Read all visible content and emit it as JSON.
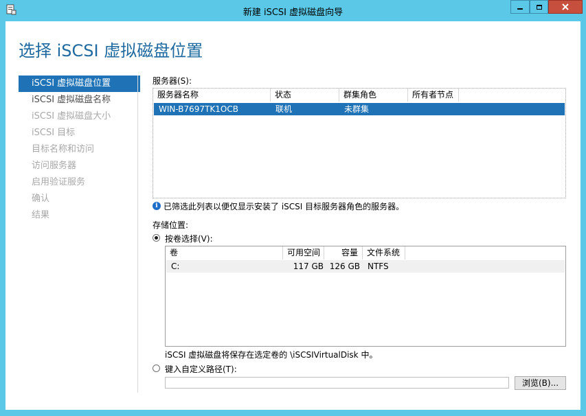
{
  "window": {
    "title": "新建 iSCSI 虚拟磁盘向导",
    "min_glyph": "▁",
    "max_glyph": "□",
    "close_glyph": "✕"
  },
  "page": {
    "title": "选择 iSCSI 虚拟磁盘位置"
  },
  "nav": {
    "items": [
      {
        "label": "iSCSI 虚拟磁盘位置",
        "state": "active"
      },
      {
        "label": "iSCSI 虚拟磁盘名称",
        "state": "enabled"
      },
      {
        "label": "iSCSI 虚拟磁盘大小",
        "state": "disabled"
      },
      {
        "label": "iSCSI 目标",
        "state": "disabled"
      },
      {
        "label": "目标名称和访问",
        "state": "disabled"
      },
      {
        "label": "访问服务器",
        "state": "disabled"
      },
      {
        "label": "启用验证服务",
        "state": "disabled"
      },
      {
        "label": "确认",
        "state": "disabled"
      },
      {
        "label": "结果",
        "state": "disabled"
      }
    ]
  },
  "server": {
    "label": "服务器(S):",
    "columns": [
      "服务器名称",
      "状态",
      "群集角色",
      "所有者节点"
    ],
    "rows": [
      {
        "name": "WIN-B7697TK1OCB",
        "status": "联机",
        "cluster_role": "未群集",
        "owner": ""
      }
    ],
    "info_text": "已筛选此列表以便仅显示安装了 iSCSI 目标服务器角色的服务器。"
  },
  "storage": {
    "label": "存储位置:",
    "by_volume_label": "按卷选择(V):",
    "volume_columns": [
      "卷",
      "可用空间",
      "容量",
      "文件系统"
    ],
    "volumes": [
      {
        "volume": "C:",
        "free": "117 GB",
        "capacity": "126 GB",
        "fs": "NTFS"
      }
    ],
    "save_note": "iSCSI 虚拟磁盘将保存在选定卷的 \\iSCSIVirtualDisk 中。",
    "custom_path_label": "键入自定义路径(T):",
    "custom_path_value": "",
    "browse_label": "浏览(B)..."
  },
  "colors": {
    "accent": "#1e72b5",
    "title_blue": "#1e6aa0",
    "frame": "#5ac8e6"
  }
}
